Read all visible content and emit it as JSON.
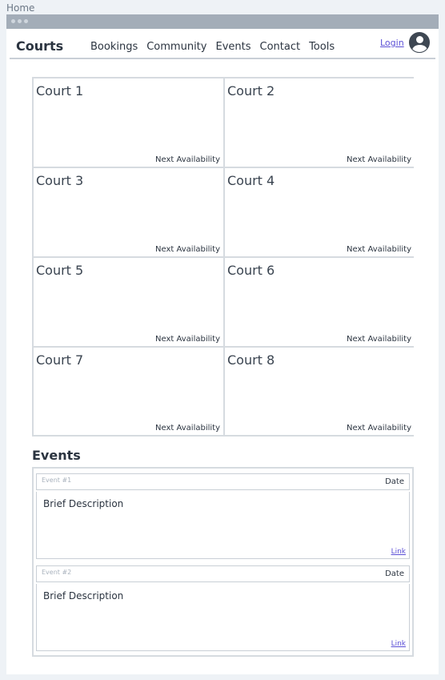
{
  "page_label": "Home",
  "navbar": {
    "brand": "Courts",
    "items": [
      "Bookings",
      "Community",
      "Events",
      "Contact",
      "Tools"
    ],
    "login": "Login"
  },
  "courts": [
    {
      "name": "Court 1",
      "availability": "Next Availability"
    },
    {
      "name": "Court 2",
      "availability": "Next Availability"
    },
    {
      "name": "Court 3",
      "availability": "Next Availability"
    },
    {
      "name": "Court 4",
      "availability": "Next Availability"
    },
    {
      "name": "Court 5",
      "availability": "Next Availability"
    },
    {
      "name": "Court 6",
      "availability": "Next Availability"
    },
    {
      "name": "Court 7",
      "availability": "Next Availability"
    },
    {
      "name": "Court 8",
      "availability": "Next Availability"
    }
  ],
  "events": {
    "heading": "Events",
    "items": [
      {
        "number": "Event #1",
        "date": "Date",
        "description": "Brief Description",
        "link": "Link"
      },
      {
        "number": "Event #2",
        "date": "Date",
        "description": "Brief Description",
        "link": "Link"
      }
    ]
  },
  "icons": {
    "avatar": "user-avatar-icon",
    "window_dots": "window-dots-icon"
  }
}
